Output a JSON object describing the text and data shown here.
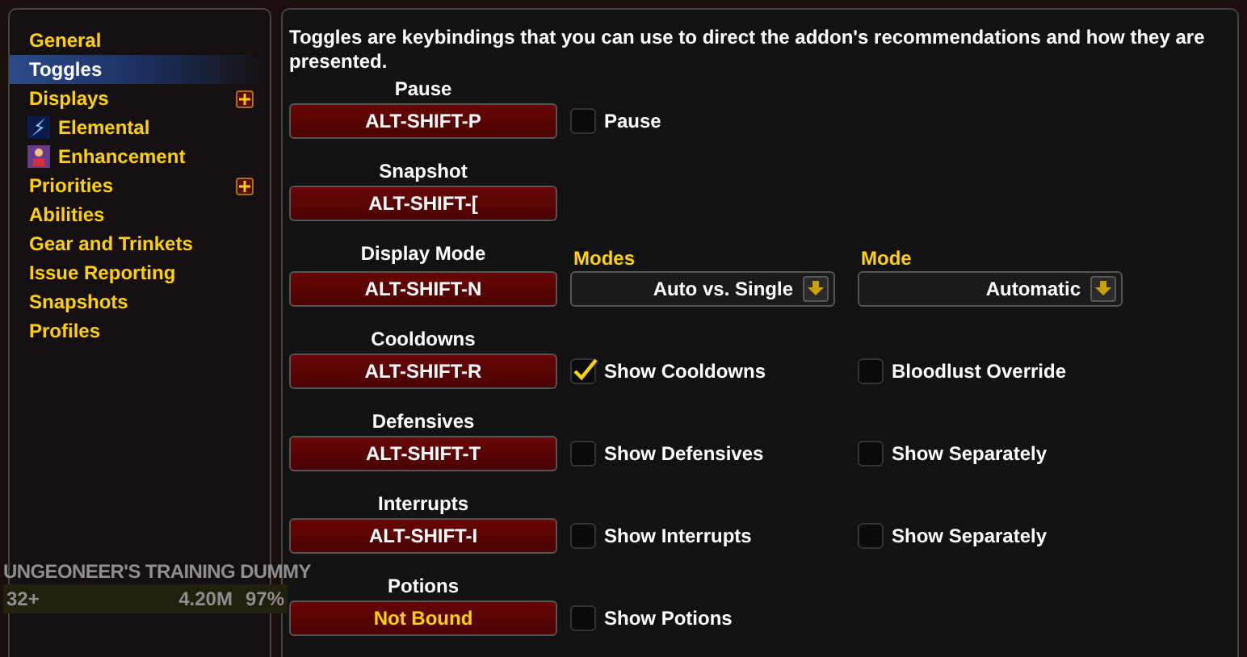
{
  "sidebar": {
    "items": [
      {
        "label": "General",
        "selected": false
      },
      {
        "label": "Toggles",
        "selected": true
      },
      {
        "label": "Displays",
        "selected": false,
        "expandable": true,
        "children": [
          {
            "label": "Elemental",
            "selected": false,
            "kind": "lightning"
          },
          {
            "label": "Enhancement",
            "selected": false,
            "kind": "figure"
          }
        ]
      },
      {
        "label": "Priorities",
        "selected": false,
        "expandable": true
      },
      {
        "label": "Abilities",
        "selected": false
      },
      {
        "label": "Gear and Trinkets",
        "selected": false
      },
      {
        "label": "Issue Reporting",
        "selected": false
      },
      {
        "label": "Snapshots",
        "selected": false
      },
      {
        "label": "Profiles",
        "selected": false
      }
    ]
  },
  "background_nameplate": {
    "name": "UNGEONEER'S TRAINING DUMMY",
    "level": "32+",
    "health": "4.20M",
    "percent": "97%"
  },
  "description": "Toggles are keybindings that you can use to direct the addon's recommendations and how they are presented.",
  "toggles": [
    {
      "label": "Pause",
      "key": "ALT-SHIFT-P",
      "bound": true,
      "options": [
        {
          "kind": "checkbox",
          "label": "Pause",
          "checked": false
        }
      ]
    },
    {
      "label": "Snapshot",
      "key": "ALT-SHIFT-[",
      "bound": true
    },
    {
      "label": "Display Mode",
      "key": "ALT-SHIFT-N",
      "bound": true,
      "options": [
        {
          "kind": "dropdown",
          "label": "Modes",
          "value": "Auto vs. Single"
        },
        {
          "kind": "dropdown",
          "label": "Mode",
          "value": "Automatic"
        }
      ]
    },
    {
      "label": "Cooldowns",
      "key": "ALT-SHIFT-R",
      "bound": true,
      "options": [
        {
          "kind": "checkbox",
          "label": "Show Cooldowns",
          "checked": true
        },
        {
          "kind": "checkbox",
          "label": "Bloodlust Override",
          "checked": false
        }
      ]
    },
    {
      "label": "Defensives",
      "key": "ALT-SHIFT-T",
      "bound": true,
      "options": [
        {
          "kind": "checkbox",
          "label": "Show Defensives",
          "checked": false
        },
        {
          "kind": "checkbox",
          "label": "Show Separately",
          "checked": false
        }
      ]
    },
    {
      "label": "Interrupts",
      "key": "ALT-SHIFT-I",
      "bound": true,
      "options": [
        {
          "kind": "checkbox",
          "label": "Show Interrupts",
          "checked": false
        },
        {
          "kind": "checkbox",
          "label": "Show Separately",
          "checked": false
        }
      ]
    },
    {
      "label": "Potions",
      "key": "Not Bound",
      "bound": false,
      "options": [
        {
          "kind": "checkbox",
          "label": "Show Potions",
          "checked": false
        }
      ]
    }
  ]
}
